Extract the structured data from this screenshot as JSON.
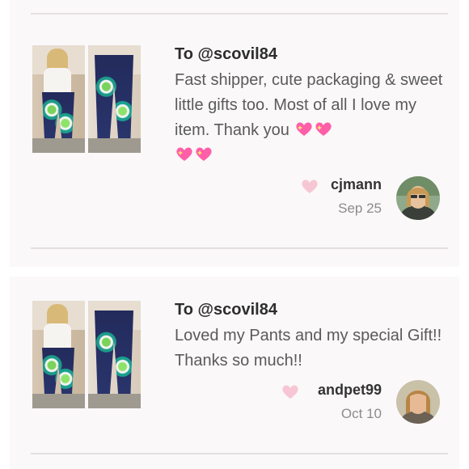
{
  "reviews": [
    {
      "to": "To @scovil84",
      "message_part1": "Fast shipper, cute packaging & sweet little gifts too. Most of all I love my item. Thank you",
      "username": "cjmann",
      "date": "Sep 25",
      "emoji": "sparkling-heart"
    },
    {
      "to": "To @scovil84",
      "message": "Loved my Pants and my special Gift!! Thanks so much!!",
      "username": "andpet99",
      "date": "Oct 10"
    }
  ],
  "colors": {
    "heart": "#f7c6d4",
    "emoji_heart": "#ff5ea8",
    "background": "#faf8f9"
  }
}
